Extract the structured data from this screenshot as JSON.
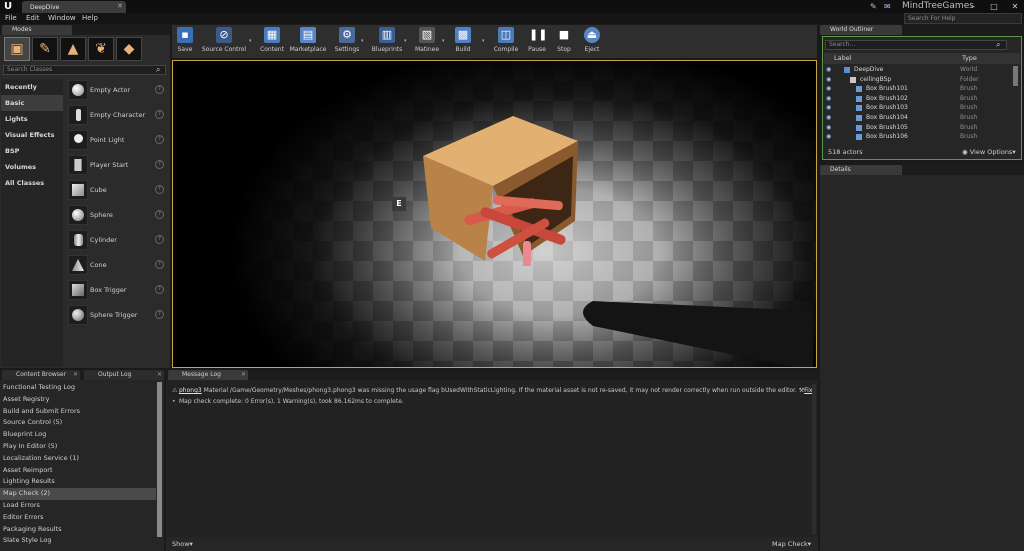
{
  "window": {
    "doc_tab": "DeepDive",
    "tab_close": "✕",
    "company": "MindTreeGames",
    "search_help_placeholder": "Search For Help",
    "logo": "U"
  },
  "menu": [
    "File",
    "Edit",
    "Window",
    "Help"
  ],
  "modes": {
    "tab_label": "Modes",
    "search_placeholder": "Search Classes",
    "categories": [
      "Recently Placed",
      "Basic",
      "Lights",
      "Visual Effects",
      "BSP",
      "Volumes",
      "All Classes"
    ],
    "selected_category": "Basic",
    "items": [
      "Empty Actor",
      "Empty Character",
      "Point Light",
      "Player Start",
      "Cube",
      "Sphere",
      "Cylinder",
      "Cone",
      "Box Trigger",
      "Sphere Trigger"
    ]
  },
  "toolbar": {
    "buttons": [
      "Save",
      "Source Control",
      "Content",
      "Marketplace",
      "Settings",
      "Blueprints",
      "Matinee",
      "Build",
      "Compile",
      "Pause",
      "Stop",
      "Eject"
    ]
  },
  "viewport": {
    "marker": "E"
  },
  "world_outliner": {
    "tab_label": "World Outliner",
    "search_placeholder": "Search...",
    "columns": {
      "label": "Label",
      "type": "Type"
    },
    "rows": [
      {
        "label": "DeepDive",
        "type": "World"
      },
      {
        "label": "ceilingBSp",
        "type": "Folder"
      },
      {
        "label": "Box Brush101",
        "type": "Brush"
      },
      {
        "label": "Box Brush102",
        "type": "Brush"
      },
      {
        "label": "Box Brush103",
        "type": "Brush"
      },
      {
        "label": "Box Brush104",
        "type": "Brush"
      },
      {
        "label": "Box Brush105",
        "type": "Brush"
      },
      {
        "label": "Box Brush106",
        "type": "Brush"
      }
    ],
    "actor_count": "518 actors",
    "view_options": "View Options"
  },
  "details": {
    "tab_label": "Details"
  },
  "bottom": {
    "tabs": [
      "Content Browser",
      "Output Log",
      "Message Log"
    ],
    "active_tab": "Message Log",
    "log_categories": [
      "Functional Testing Log",
      "Asset Registry",
      "Build and Submit Errors",
      "Source Control (5)",
      "Blueprint Log",
      "Play In Editor (5)",
      "Localization Service (1)",
      "Asset Reimport",
      "Lighting Results",
      "Map Check (2)",
      "Load Errors",
      "Editor Errors",
      "Packaging Results",
      "Slate Style Log"
    ],
    "selected_category": "Map Check (2)",
    "messages": [
      {
        "prefix": "phong3",
        "text": "Material /Game/Geometry/Meshes/phong3.phong3 was missing the usage flag bUsedWithStaticLighting. If the material asset is not re-saved, it may not render correctly when run outside the editor.",
        "action": "Fix"
      },
      {
        "prefix": "",
        "text": "Map check complete: 0 Error(s), 1 Warning(s), took 86.162ms to complete.",
        "action": ""
      }
    ],
    "show_label": "Show",
    "filter_label": "Map Check"
  },
  "colors": {
    "viewport_border": "#c9a34a",
    "outliner_border": "#5a9a4a",
    "crate": "#d6a25e",
    "pipes": "#d9594a"
  }
}
